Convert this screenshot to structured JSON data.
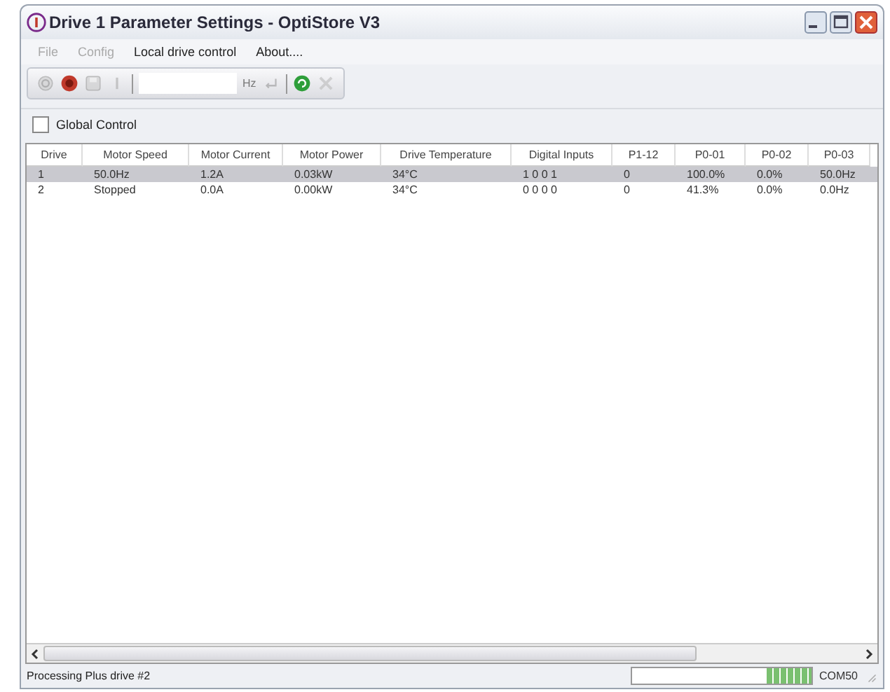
{
  "window": {
    "title": "Drive 1 Parameter Settings - OptiStore V3"
  },
  "menu": [
    {
      "label": "File",
      "disabled": true
    },
    {
      "label": "Config",
      "disabled": true
    },
    {
      "label": "Local drive control",
      "disabled": false
    },
    {
      "label": "About....",
      "disabled": false
    }
  ],
  "toolbar": {
    "buttons": [
      {
        "kind": "power",
        "disabled": true
      },
      {
        "kind": "stop",
        "disabled": false
      },
      {
        "kind": "save",
        "disabled": true
      },
      {
        "kind": "info",
        "disabled": true
      }
    ],
    "speed_field": {
      "unit": "Hz"
    },
    "after": [
      {
        "kind": "enter",
        "disabled": true
      },
      {
        "kind": "refresh",
        "disabled": false
      },
      {
        "kind": "tools",
        "disabled": true
      }
    ]
  },
  "global_control": {
    "label": "Global Control",
    "checked": false
  },
  "table": {
    "columns": [
      "Drive",
      "Motor Speed",
      "Motor Current",
      "Motor Power",
      "Drive Temperature",
      "Digital Inputs",
      "P1-12",
      "P0-01",
      "P0-02",
      "P0-03"
    ],
    "rows": [
      {
        "selected": true,
        "cells": [
          "1",
          "50.0Hz",
          "1.2A",
          "0.03kW",
          "34°C",
          "1 0 0 1",
          "0",
          "100.0%",
          "0.0%",
          "50.0Hz"
        ]
      },
      {
        "selected": false,
        "cells": [
          "2",
          "Stopped",
          "0.0A",
          "0.00kW",
          "34°C",
          "0 0 0 0",
          "0",
          "41.3%",
          "0.0%",
          "0.0Hz"
        ]
      }
    ]
  },
  "status_bar": {
    "message": "Processing Plus drive #2",
    "progress": {
      "level": 0.25
    },
    "port": "COM50"
  }
}
